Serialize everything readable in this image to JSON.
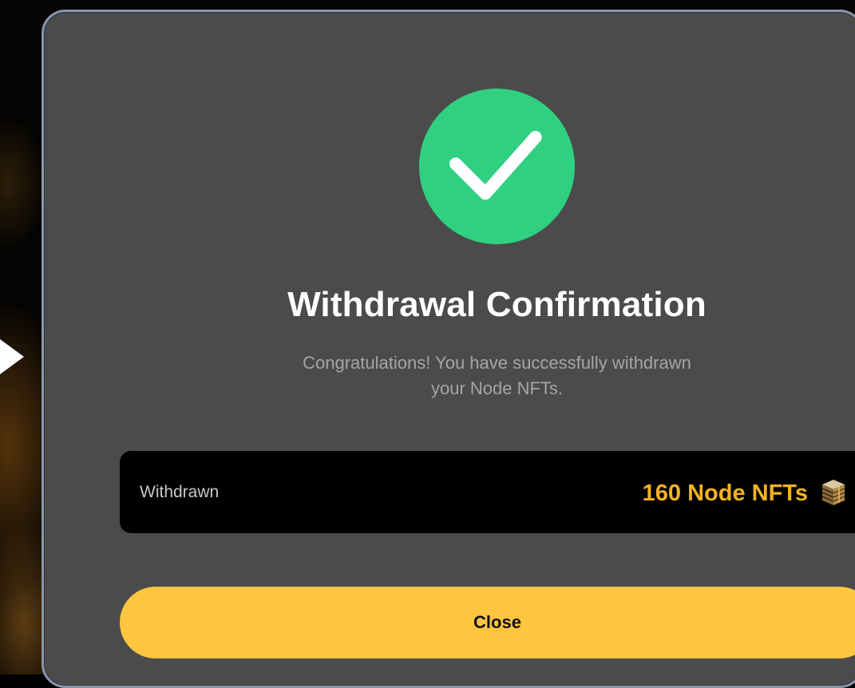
{
  "modal": {
    "icon": "checkmark-icon",
    "title": "Withdrawal Confirmation",
    "message_line1": "Congratulations! You have successfully withdrawn",
    "message_line2": "your Node NFTs.",
    "summary": {
      "label": "Withdrawn",
      "amount": "160 Node NFTs",
      "amount_icon": "node-nft-stack-icon"
    },
    "close_label": "Close"
  },
  "background": {
    "icon": "play-arrow-icon"
  },
  "colors": {
    "success": "#2fd181",
    "accent": "#fec541",
    "amount": "#f4b323",
    "modal_bg": "#4b4b4b"
  }
}
